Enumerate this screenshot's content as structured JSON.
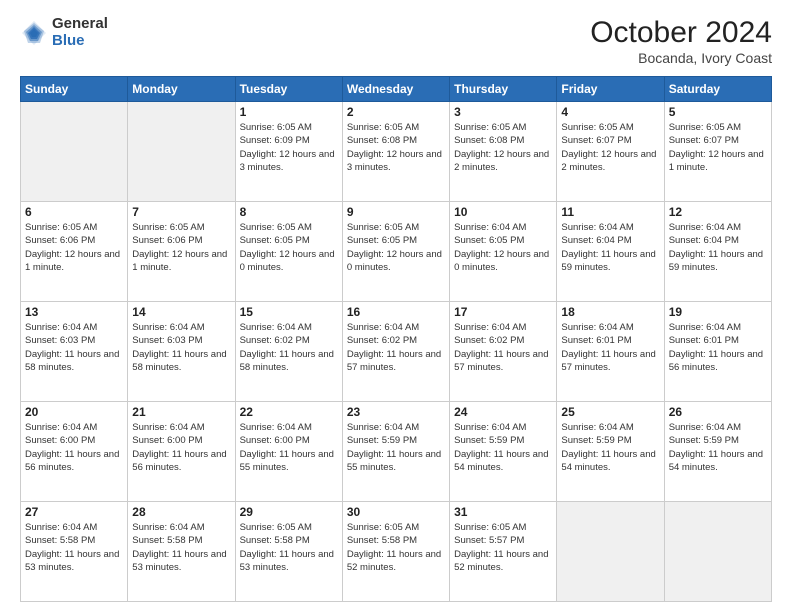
{
  "header": {
    "logo_general": "General",
    "logo_blue": "Blue",
    "title": "October 2024",
    "subtitle": "Bocanda, Ivory Coast"
  },
  "weekdays": [
    "Sunday",
    "Monday",
    "Tuesday",
    "Wednesday",
    "Thursday",
    "Friday",
    "Saturday"
  ],
  "weeks": [
    [
      {
        "day": "",
        "info": ""
      },
      {
        "day": "",
        "info": ""
      },
      {
        "day": "1",
        "info": "Sunrise: 6:05 AM\nSunset: 6:09 PM\nDaylight: 12 hours\nand 3 minutes."
      },
      {
        "day": "2",
        "info": "Sunrise: 6:05 AM\nSunset: 6:08 PM\nDaylight: 12 hours\nand 3 minutes."
      },
      {
        "day": "3",
        "info": "Sunrise: 6:05 AM\nSunset: 6:08 PM\nDaylight: 12 hours\nand 2 minutes."
      },
      {
        "day": "4",
        "info": "Sunrise: 6:05 AM\nSunset: 6:07 PM\nDaylight: 12 hours\nand 2 minutes."
      },
      {
        "day": "5",
        "info": "Sunrise: 6:05 AM\nSunset: 6:07 PM\nDaylight: 12 hours\nand 1 minute."
      }
    ],
    [
      {
        "day": "6",
        "info": "Sunrise: 6:05 AM\nSunset: 6:06 PM\nDaylight: 12 hours\nand 1 minute."
      },
      {
        "day": "7",
        "info": "Sunrise: 6:05 AM\nSunset: 6:06 PM\nDaylight: 12 hours\nand 1 minute."
      },
      {
        "day": "8",
        "info": "Sunrise: 6:05 AM\nSunset: 6:05 PM\nDaylight: 12 hours\nand 0 minutes."
      },
      {
        "day": "9",
        "info": "Sunrise: 6:05 AM\nSunset: 6:05 PM\nDaylight: 12 hours\nand 0 minutes."
      },
      {
        "day": "10",
        "info": "Sunrise: 6:04 AM\nSunset: 6:05 PM\nDaylight: 12 hours\nand 0 minutes."
      },
      {
        "day": "11",
        "info": "Sunrise: 6:04 AM\nSunset: 6:04 PM\nDaylight: 11 hours\nand 59 minutes."
      },
      {
        "day": "12",
        "info": "Sunrise: 6:04 AM\nSunset: 6:04 PM\nDaylight: 11 hours\nand 59 minutes."
      }
    ],
    [
      {
        "day": "13",
        "info": "Sunrise: 6:04 AM\nSunset: 6:03 PM\nDaylight: 11 hours\nand 58 minutes."
      },
      {
        "day": "14",
        "info": "Sunrise: 6:04 AM\nSunset: 6:03 PM\nDaylight: 11 hours\nand 58 minutes."
      },
      {
        "day": "15",
        "info": "Sunrise: 6:04 AM\nSunset: 6:02 PM\nDaylight: 11 hours\nand 58 minutes."
      },
      {
        "day": "16",
        "info": "Sunrise: 6:04 AM\nSunset: 6:02 PM\nDaylight: 11 hours\nand 57 minutes."
      },
      {
        "day": "17",
        "info": "Sunrise: 6:04 AM\nSunset: 6:02 PM\nDaylight: 11 hours\nand 57 minutes."
      },
      {
        "day": "18",
        "info": "Sunrise: 6:04 AM\nSunset: 6:01 PM\nDaylight: 11 hours\nand 57 minutes."
      },
      {
        "day": "19",
        "info": "Sunrise: 6:04 AM\nSunset: 6:01 PM\nDaylight: 11 hours\nand 56 minutes."
      }
    ],
    [
      {
        "day": "20",
        "info": "Sunrise: 6:04 AM\nSunset: 6:00 PM\nDaylight: 11 hours\nand 56 minutes."
      },
      {
        "day": "21",
        "info": "Sunrise: 6:04 AM\nSunset: 6:00 PM\nDaylight: 11 hours\nand 56 minutes."
      },
      {
        "day": "22",
        "info": "Sunrise: 6:04 AM\nSunset: 6:00 PM\nDaylight: 11 hours\nand 55 minutes."
      },
      {
        "day": "23",
        "info": "Sunrise: 6:04 AM\nSunset: 5:59 PM\nDaylight: 11 hours\nand 55 minutes."
      },
      {
        "day": "24",
        "info": "Sunrise: 6:04 AM\nSunset: 5:59 PM\nDaylight: 11 hours\nand 54 minutes."
      },
      {
        "day": "25",
        "info": "Sunrise: 6:04 AM\nSunset: 5:59 PM\nDaylight: 11 hours\nand 54 minutes."
      },
      {
        "day": "26",
        "info": "Sunrise: 6:04 AM\nSunset: 5:59 PM\nDaylight: 11 hours\nand 54 minutes."
      }
    ],
    [
      {
        "day": "27",
        "info": "Sunrise: 6:04 AM\nSunset: 5:58 PM\nDaylight: 11 hours\nand 53 minutes."
      },
      {
        "day": "28",
        "info": "Sunrise: 6:04 AM\nSunset: 5:58 PM\nDaylight: 11 hours\nand 53 minutes."
      },
      {
        "day": "29",
        "info": "Sunrise: 6:05 AM\nSunset: 5:58 PM\nDaylight: 11 hours\nand 53 minutes."
      },
      {
        "day": "30",
        "info": "Sunrise: 6:05 AM\nSunset: 5:58 PM\nDaylight: 11 hours\nand 52 minutes."
      },
      {
        "day": "31",
        "info": "Sunrise: 6:05 AM\nSunset: 5:57 PM\nDaylight: 11 hours\nand 52 minutes."
      },
      {
        "day": "",
        "info": ""
      },
      {
        "day": "",
        "info": ""
      }
    ]
  ]
}
